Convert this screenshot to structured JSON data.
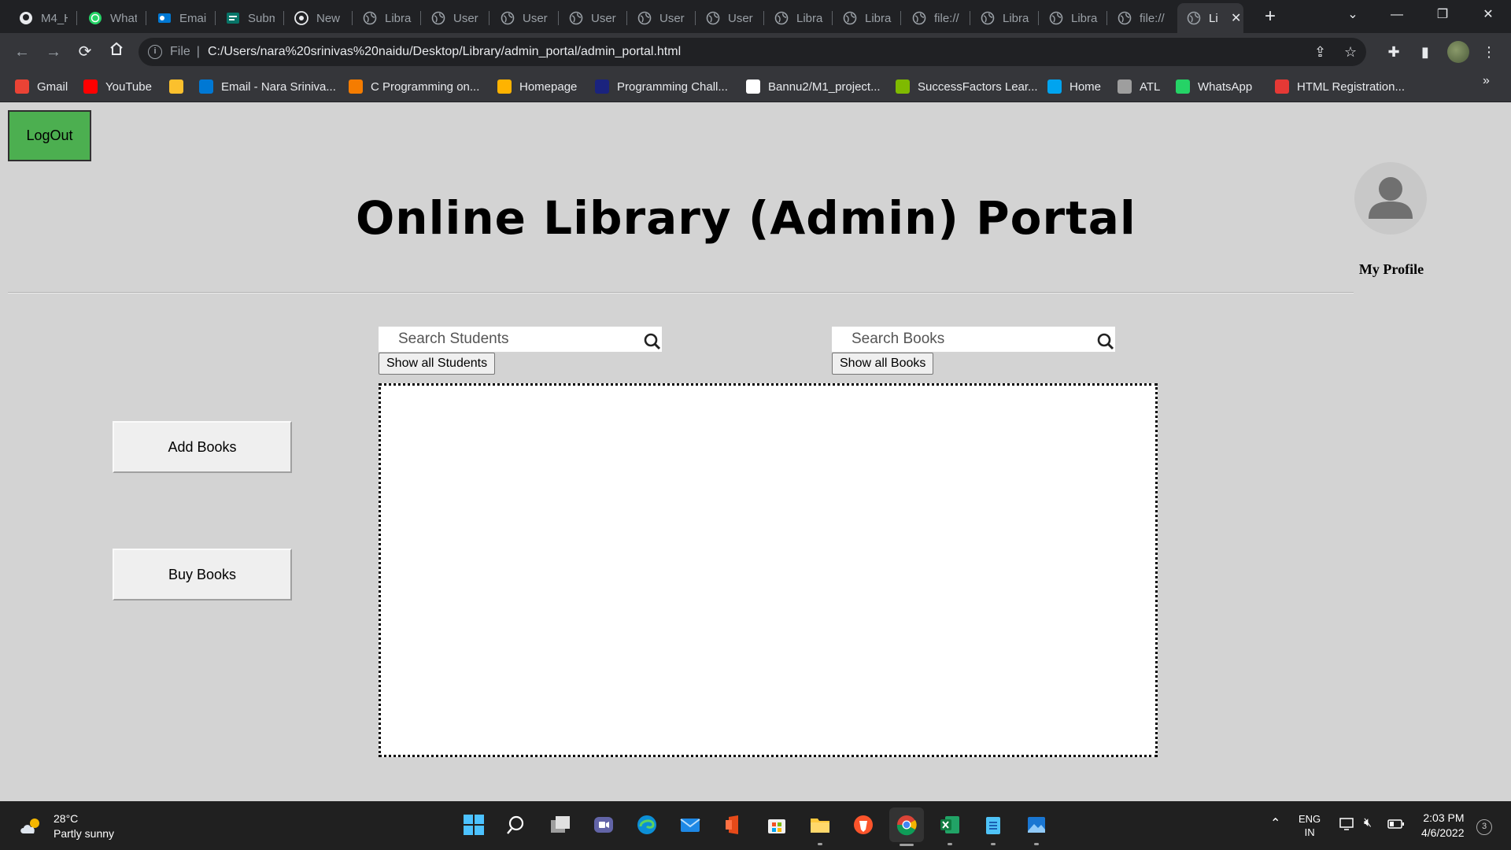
{
  "browser": {
    "tabs": [
      {
        "title": "M4_H",
        "icon": "github-icon"
      },
      {
        "title": "What",
        "icon": "whatsapp-icon"
      },
      {
        "title": "Email",
        "icon": "outlook-icon"
      },
      {
        "title": "Subm",
        "icon": "forms-icon"
      },
      {
        "title": "New T",
        "icon": "chrome-icon"
      },
      {
        "title": "Librar",
        "icon": "globe-icon"
      },
      {
        "title": "User I",
        "icon": "globe-icon"
      },
      {
        "title": "User I",
        "icon": "globe-icon"
      },
      {
        "title": "User I",
        "icon": "globe-icon"
      },
      {
        "title": "User I",
        "icon": "globe-icon"
      },
      {
        "title": "User I",
        "icon": "globe-icon"
      },
      {
        "title": "Librar",
        "icon": "globe-icon"
      },
      {
        "title": "Librar",
        "icon": "globe-icon"
      },
      {
        "title": "file://",
        "icon": "globe-icon"
      },
      {
        "title": "Librar",
        "icon": "globe-icon"
      },
      {
        "title": "Librar",
        "icon": "globe-icon"
      },
      {
        "title": "file://",
        "icon": "globe-icon"
      },
      {
        "title": "Li",
        "icon": "globe-icon",
        "active": true
      }
    ],
    "new_tab_symbol": "+",
    "address": {
      "scheme": "File",
      "url": "C:/Users/nara%20srinivas%20naidu/Desktop/Library/admin_portal/admin_portal.html"
    },
    "bookmarks": [
      {
        "label": "Gmail",
        "color": "#ea4335"
      },
      {
        "label": "YouTube",
        "color": "#ff0000"
      },
      {
        "label": "",
        "color": "#fbc02d"
      },
      {
        "label": "Email - Nara Sriniva...",
        "color": "#0078d4"
      },
      {
        "label": "C Programming on...",
        "color": "#f57c00"
      },
      {
        "label": "Homepage",
        "color": "#ffb300"
      },
      {
        "label": "Programming Chall...",
        "color": "#1a237e"
      },
      {
        "label": "Bannu2/M1_project...",
        "color": "#ffffff"
      },
      {
        "label": "SuccessFactors Lear...",
        "color": "#7fba00"
      },
      {
        "label": "Home",
        "color": "#00a4ef"
      },
      {
        "label": "ATL",
        "color": "#9e9e9e"
      },
      {
        "label": "WhatsApp",
        "color": "#25d366"
      },
      {
        "label": "HTML Registration...",
        "color": "#e53935"
      }
    ],
    "more_bookmarks": "»"
  },
  "page": {
    "logout_label": "LogOut",
    "title": "Online Library (Admin) Portal",
    "profile_label": "My Profile",
    "search_students": {
      "placeholder": "Search Students",
      "button": "Show all Students"
    },
    "search_books": {
      "placeholder": "Search Books",
      "button": "Show all Books"
    },
    "add_books_label": "Add Books",
    "buy_books_label": "Buy Books",
    "logout_color": "#4caf50"
  },
  "taskbar": {
    "weather": {
      "temp": "28°C",
      "condition": "Partly sunny"
    },
    "apps": [
      "windows-start-icon",
      "search-icon",
      "task-view-icon",
      "teams-chat-icon",
      "edge-icon",
      "mail-icon",
      "office-icon",
      "store-icon",
      "file-explorer-icon",
      "brave-icon",
      "chrome-icon",
      "excel-icon",
      "notepad-icon",
      "photos-icon"
    ],
    "language": {
      "line1": "ENG",
      "line2": "IN"
    },
    "time": "2:03 PM",
    "date": "4/6/2022",
    "notification_count": "3"
  }
}
